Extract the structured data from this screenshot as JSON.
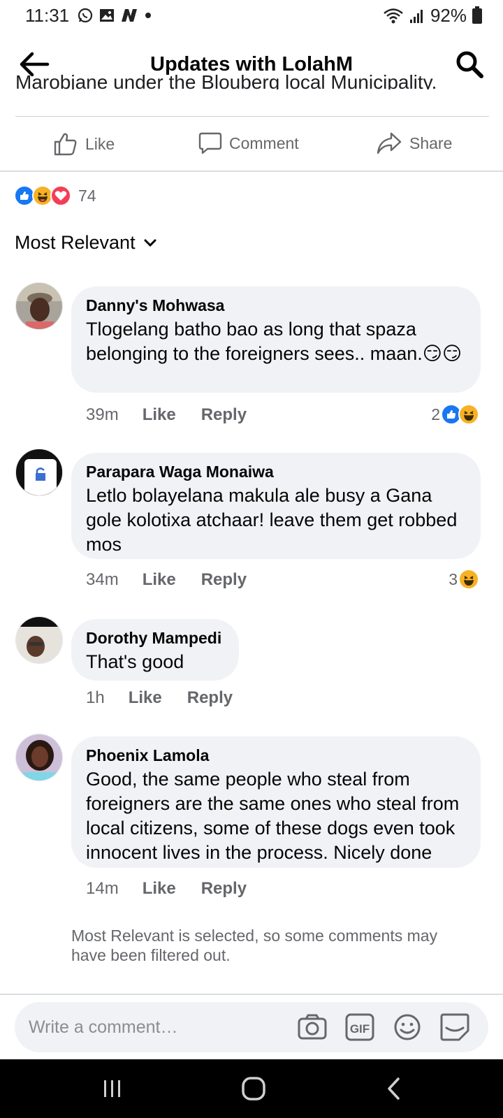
{
  "status_bar": {
    "time": "11:31",
    "battery": "92%",
    "left_icons": [
      "whatsapp-icon",
      "gallery-icon",
      "n-app-icon",
      "dot-icon"
    ],
    "right_icons": [
      "wifi-icon",
      "signal-icon",
      "battery-icon"
    ]
  },
  "header": {
    "title": "Updates with LolahM"
  },
  "post": {
    "cut_text": "Marobjane under the Blouberg local Municipality.",
    "actions": {
      "like": "Like",
      "comment": "Comment",
      "share": "Share"
    },
    "reaction_count": "74",
    "reaction_types": [
      "like",
      "haha",
      "love"
    ]
  },
  "sort": {
    "label": "Most Relevant"
  },
  "comments": [
    {
      "author": "Danny's Mohwasa",
      "text": "Tlogelang batho bao as long that spaza belonging to the foreigners sees.. maan.😏😏",
      "time": "39m",
      "like": "Like",
      "reply": "Reply",
      "reaction_count": "2",
      "reactions": [
        "like",
        "haha"
      ]
    },
    {
      "author": "Parapara Waga Monaiwa",
      "text": "Letlo bolayelana makula ale busy a Gana gole kolotixa atchaar! leave them get robbed mos",
      "time": "34m",
      "like": "Like",
      "reply": "Reply",
      "reaction_count": "3",
      "reactions": [
        "haha"
      ]
    },
    {
      "author": "Dorothy Mampedi",
      "text": "That's good",
      "time": "1h",
      "like": "Like",
      "reply": "Reply"
    },
    {
      "author": "Phoenix Lamola",
      "text": "Good, the same people who steal from foreigners are the same ones who steal from local citizens, some of these dogs even took innocent lives in the process. Nicely done",
      "time": "14m",
      "like": "Like",
      "reply": "Reply"
    }
  ],
  "filter_note": "Most Relevant is selected, so some comments may have been filtered out.",
  "composer": {
    "placeholder": "Write a comment…",
    "icons": [
      "camera-icon",
      "gif-icon",
      "emoji-icon",
      "sticker-icon"
    ]
  },
  "colors": {
    "like_blue": "#1877f2",
    "haha_yellow": "#f7b125",
    "love_red": "#f33e58",
    "bubble_grey": "#f0f2f5",
    "secondary_text": "#65676b"
  }
}
